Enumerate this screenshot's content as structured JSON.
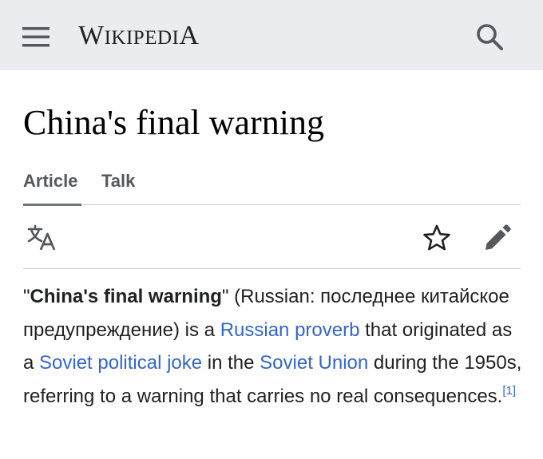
{
  "header": {
    "menu_icon": "hamburger-menu-icon",
    "wordmark_first": "W",
    "wordmark_mid": "IKIPEDI",
    "wordmark_last": "A",
    "search_icon": "magnifier-icon"
  },
  "page": {
    "title": "China's final warning"
  },
  "tabs": [
    {
      "label": "Article",
      "selected": true
    },
    {
      "label": "Talk",
      "selected": false
    }
  ],
  "toolbar": {
    "language_icon": "language-icon",
    "watch_icon": "star-icon",
    "edit_icon": "pencil-icon"
  },
  "lead": {
    "quote_open": "\"",
    "term": "China's final warning",
    "quote_close": "\"",
    "gloss": " (Russian: последнее китайское предупреждение) is a ",
    "link_proverb": "Russian proverb",
    "text_2": " that originated as a ",
    "link_joke": "Soviet political joke",
    "text_3": " in the ",
    "link_union": "Soviet Union",
    "text_4": " during the 1950s, referring to a warning that carries no real consequences.",
    "citation": "[1]"
  },
  "colors": {
    "header_bg": "#eaecf0",
    "link": "#3366cc",
    "text": "#202122",
    "icon": "#54595d"
  }
}
